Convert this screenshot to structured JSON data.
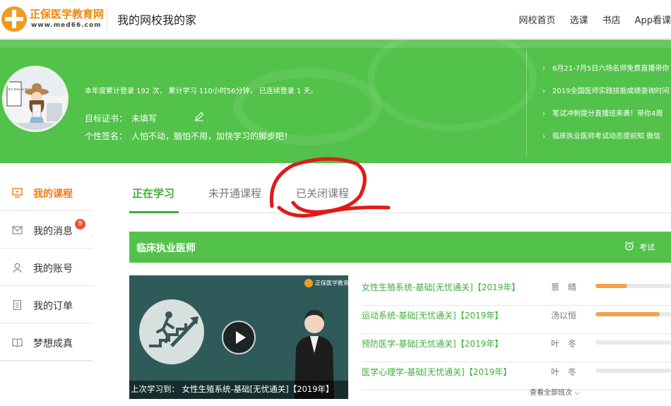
{
  "header": {
    "logo_name": "正保医学教育网",
    "logo_url": "www.med66.com",
    "site_title": "我的网校我的家",
    "nav": [
      "网校首页",
      "选课",
      "书店",
      "App看课"
    ]
  },
  "profile": {
    "stats": "本年度累计登录 192 次， 累计学习 110小时56分钟， 已连续登录 1 天。",
    "cert_label": "目标证书：",
    "cert_value": "未填写",
    "sign_label": "个性签名：",
    "sign_value": "人怕不动，脑怕不用，加快学习的脚步吧！",
    "avatar_text": "It's Time to Travel"
  },
  "news": [
    "6月21-7月5日六场名师免费直播带你",
    "2019全国医师实践技能成绩查询时间",
    "笔试冲刺提分直播班来袭！带你4周",
    "临床执业医师考试动态提前知 微信"
  ],
  "sidebar": {
    "items": [
      {
        "label": "我的课程",
        "icon": "monitor-icon",
        "active": true
      },
      {
        "label": "我的消息",
        "icon": "mail-icon",
        "badge": "9"
      },
      {
        "label": "我的账号",
        "icon": "user-icon"
      },
      {
        "label": "我的订单",
        "icon": "order-icon"
      },
      {
        "label": "梦想成真",
        "icon": "book-icon"
      }
    ]
  },
  "tabs": [
    "正在学习",
    "未开通课程",
    "已关闭课程"
  ],
  "section": {
    "title": "临床执业医师",
    "exam_link": "考试"
  },
  "video": {
    "brand": "正保医学教育网",
    "caption": "上次学习到：  女性生殖系统-基础[无忧通关]【2019年】"
  },
  "lessons": [
    {
      "title": "女性生殖系统-基础[无忧通关]【2019年】",
      "teacher": "景　晴",
      "progress": 0.42
    },
    {
      "title": "运动系统-基础[无忧通关]【2019年】",
      "teacher": "汤以恒",
      "progress": 0.85
    },
    {
      "title": "预防医学-基础[无忧通关]【2019年】",
      "teacher": "叶　冬",
      "progress": 0
    },
    {
      "title": "医学心理学-基础[无忧通关]【2019年】",
      "teacher": "叶　冬",
      "progress": 0
    }
  ],
  "view_all": "查看全部班次",
  "colors": {
    "accent_green": "#52c24a",
    "accent_orange": "#f07d1a",
    "progress_orange": "#f5a04a",
    "badge_red": "#f0522e"
  }
}
